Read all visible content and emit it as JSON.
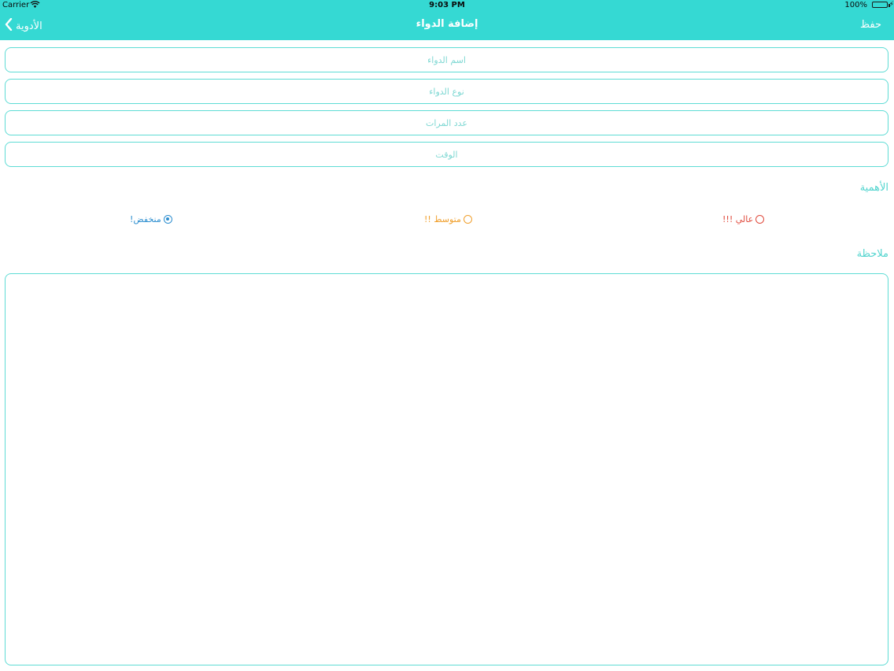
{
  "status_bar": {
    "carrier": "Carrier",
    "time": "9:03 PM",
    "battery": "100%"
  },
  "nav": {
    "back_label": "الأدوية",
    "title": "إضافة الدواء",
    "save_label": "حفظ"
  },
  "form": {
    "fields": [
      {
        "placeholder": "اسم الدواء"
      },
      {
        "placeholder": "نوع الدواء"
      },
      {
        "placeholder": "عدد المرات"
      },
      {
        "placeholder": "الوقت"
      }
    ],
    "importance": {
      "label": "الأهمية",
      "options": [
        {
          "label": "عالي !!!",
          "color": "#e04a3c",
          "selected": false
        },
        {
          "label": "متوسط !!",
          "color": "#f0a02e",
          "selected": false
        },
        {
          "label": "منخفض!",
          "color": "#2e8fd0",
          "selected": true
        }
      ]
    },
    "notes": {
      "label": "ملاحظة",
      "value": ""
    }
  },
  "colors": {
    "accent": "#35d9d3",
    "border": "#5fdcd5"
  }
}
